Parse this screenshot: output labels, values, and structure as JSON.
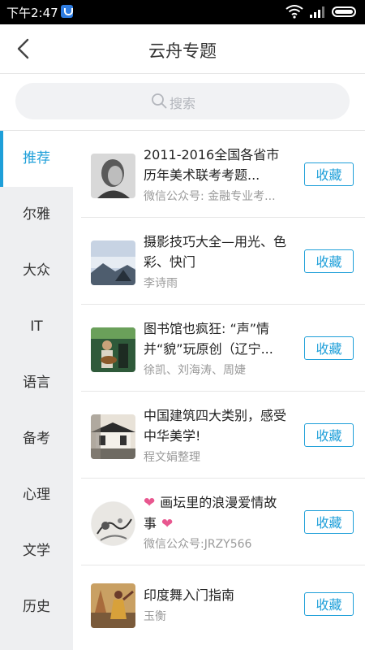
{
  "status": {
    "time": "下午2:47"
  },
  "header": {
    "title": "云舟专题"
  },
  "search": {
    "placeholder": "搜索"
  },
  "sidebar": {
    "items": [
      {
        "label": "推荐"
      },
      {
        "label": "尔雅"
      },
      {
        "label": "大众"
      },
      {
        "label": "IT"
      },
      {
        "label": "语言"
      },
      {
        "label": "备考"
      },
      {
        "label": "心理"
      },
      {
        "label": "文学"
      },
      {
        "label": "历史"
      }
    ]
  },
  "list": {
    "collect_label": "收藏",
    "items": [
      {
        "title": "2011-2016全国各省市历年美术联考考题...",
        "subtitle": "微信公众号: 金融专业考..."
      },
      {
        "title": "摄影技巧大全—用光、色彩、快门",
        "subtitle": "李诗雨"
      },
      {
        "title": "图书馆也疯狂: “声”情并“貌”玩原创（辽宁...",
        "subtitle": "徐凯、刘海涛、周婕"
      },
      {
        "title": "中国建筑四大类别，感受中华美学!",
        "subtitle": "程文娟整理"
      },
      {
        "title": "画坛里的浪漫爱情故事",
        "subtitle": "微信公众号:JRZY566"
      },
      {
        "title": "印度舞入门指南",
        "subtitle": "玉衡"
      }
    ]
  },
  "colors": {
    "accent": "#1e9fd9",
    "sidebar_bg": "#eeeff1",
    "heart": "#e8578f"
  }
}
